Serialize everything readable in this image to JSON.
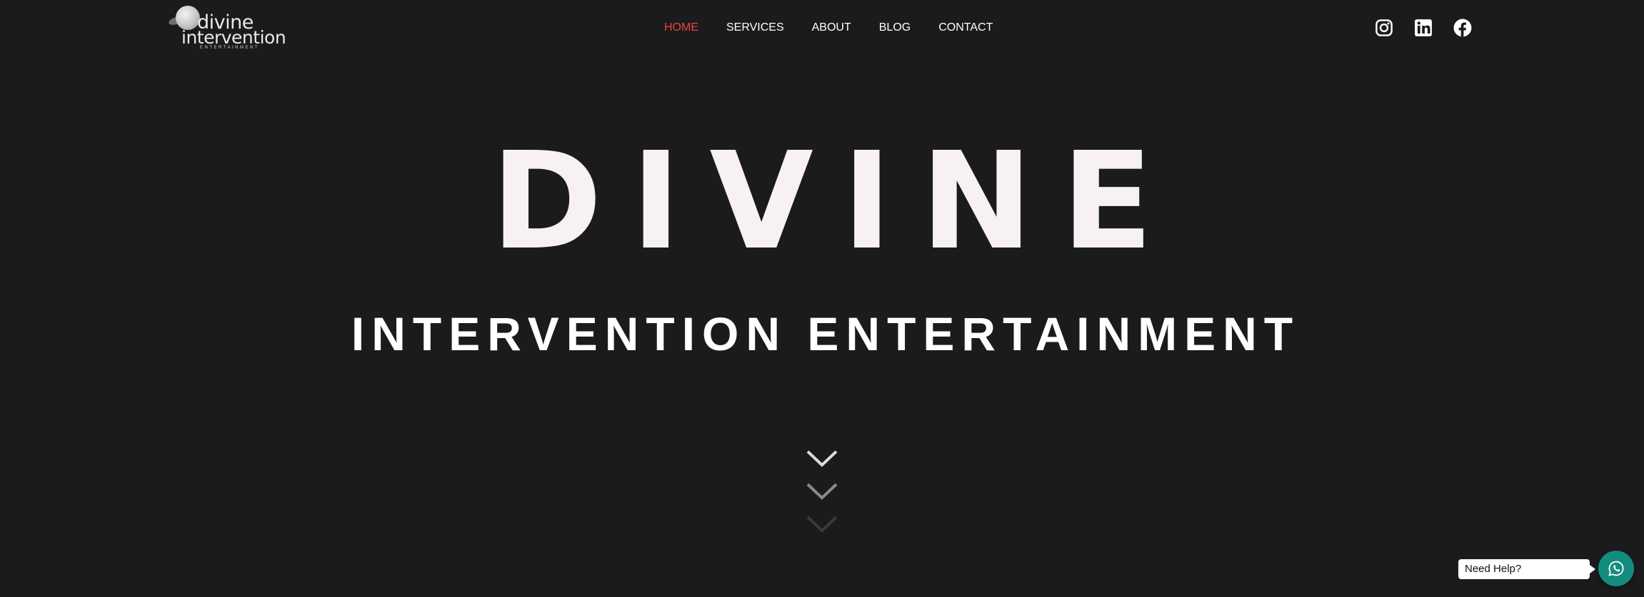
{
  "brand": {
    "line1": "divine",
    "line2": "intervention",
    "line3": "ENTERTAINMENT"
  },
  "nav": {
    "items": [
      {
        "label": "HOME",
        "active": true
      },
      {
        "label": "SERVICES",
        "active": false
      },
      {
        "label": "ABOUT",
        "active": false
      },
      {
        "label": "BLOG",
        "active": false
      },
      {
        "label": "CONTACT",
        "active": false
      }
    ]
  },
  "social": {
    "icons": [
      "instagram-icon",
      "linkedin-icon",
      "facebook-icon"
    ]
  },
  "hero": {
    "title": "DIVINE",
    "subtitle": "INTERVENTION ENTERTAINMENT"
  },
  "help": {
    "label": "Need Help?",
    "icon": "whatsapp-icon"
  },
  "colors": {
    "background": "#1b1b1d",
    "active_nav": "#e8453c",
    "hero_title": "#f7f2f1",
    "whatsapp": "#128c7e"
  }
}
